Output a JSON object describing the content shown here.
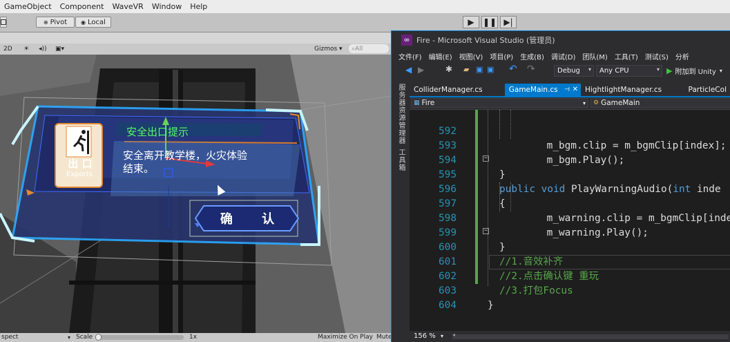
{
  "unity": {
    "menu": [
      "GameObject",
      "Component",
      "WaveVR",
      "Window",
      "Help"
    ],
    "toolbar": {
      "pivot": "Pivot",
      "local": "Local"
    },
    "scene_toolbar": {
      "mode_2d": "2D",
      "gizmos": "Gizmos",
      "search_placeholder": "All"
    },
    "game_ui": {
      "exit_label": "出 口",
      "exit_sub": "Exports",
      "title": "安全出口提示",
      "message_line1": "安全离开教学楼，火灾体验",
      "message_line2": "结束。",
      "confirm": "确 认"
    },
    "bottombar": {
      "aspect": "spect",
      "scale_label": "Scale",
      "scale_value": "1x",
      "maximize": "Maximize On Play",
      "mute": "Mute"
    }
  },
  "vs": {
    "title": "Fire - Microsoft Visual Studio (管理员)",
    "menu": [
      "文件(F)",
      "编辑(E)",
      "视图(V)",
      "项目(P)",
      "生成(B)",
      "调试(D)",
      "团队(M)",
      "工具(T)",
      "测试(S)",
      "分析"
    ],
    "toolbar": {
      "config": "Debug",
      "platform": "Any CPU",
      "attach": "附加到 Unity"
    },
    "side_labels": [
      "服务器资源管理器",
      "工具箱"
    ],
    "tabs": [
      {
        "label": "ColliderManager.cs",
        "active": false
      },
      {
        "label": "GameMain.cs",
        "active": true
      },
      {
        "label": "HightlightManager.cs",
        "active": false
      },
      {
        "label": "ParticleCol",
        "active": false
      }
    ],
    "nav": {
      "project": "Fire",
      "member": "GameMain"
    },
    "code_lines": [
      {
        "num": "592",
        "text": "    m_bgm.clip = m_bgmClip[index];"
      },
      {
        "num": "593",
        "text": "    m_bgm.Play();"
      },
      {
        "num": "594",
        "text": "}"
      },
      {
        "num": "595",
        "kw1": "public",
        "kw2": "void",
        "rest": "PlayWarningAudio(",
        "kw3": "int",
        "rest2": "inde"
      },
      {
        "num": "596",
        "text": "{"
      },
      {
        "num": "597",
        "text": "    m_warning.clip = m_bgmClip[index"
      },
      {
        "num": "598",
        "text": "    m_warning.Play();"
      },
      {
        "num": "599",
        "text": "}"
      },
      {
        "num": "600",
        "text": "//1.音效补齐"
      },
      {
        "num": "601",
        "text": "//2.点击确认键 重玩"
      },
      {
        "num": "602",
        "text": "//3.打包Focus"
      },
      {
        "num": "603",
        "text": "}"
      },
      {
        "num": "604",
        "text": ""
      }
    ],
    "zoom": "156 %"
  }
}
